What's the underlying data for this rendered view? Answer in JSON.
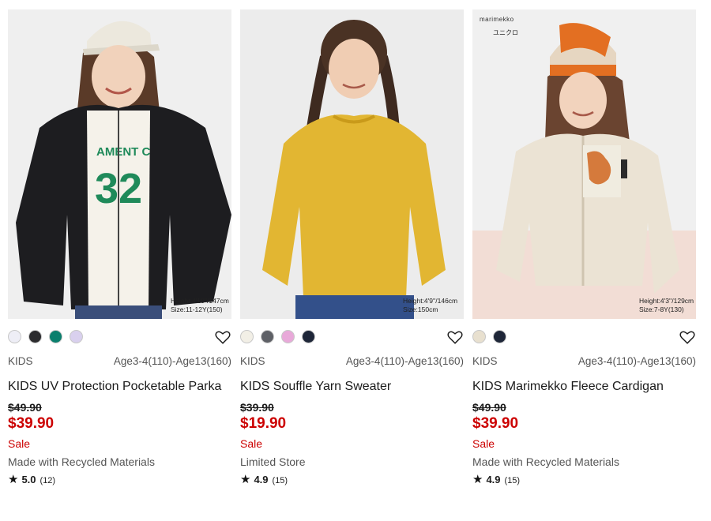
{
  "products": [
    {
      "model_height": "Height:4'10''/147cm",
      "model_size": "Size:11-12Y(150)",
      "swatches": [
        "#eeeef6",
        "#2b2b2e",
        "#0a7f6d",
        "#d9d0ee"
      ],
      "category": "KIDS",
      "sizes": "Age3-4(110)-Age13(160)",
      "title": "KIDS UV Protection Pocketable Parka",
      "old_price": "$49.90",
      "new_price": "$39.90",
      "sale": "Sale",
      "tag": "Made with Recycled Materials",
      "rating": "5.0",
      "review_count": "(12)"
    },
    {
      "model_height": "Height:4'9''/146cm",
      "model_size": "Size:150cm",
      "swatches": [
        "#f2efe6",
        "#5e6066",
        "#e8a9d9",
        "#1e2638"
      ],
      "category": "KIDS",
      "sizes": "Age3-4(110)-Age13(160)",
      "title": "KIDS Souffle Yarn Sweater",
      "old_price": "$39.90",
      "new_price": "$19.90",
      "sale": "Sale",
      "tag": "Limited Store",
      "rating": "4.9",
      "review_count": "(15)"
    },
    {
      "brand": "marimekko",
      "uq_logo": "ユニクロ",
      "model_height": "Height:4'3''/129cm",
      "model_size": "Size:7-8Y(130)",
      "swatches": [
        "#e8e0cf",
        "#1e2638"
      ],
      "category": "KIDS",
      "sizes": "Age3-4(110)-Age13(160)",
      "title": "KIDS Marimekko Fleece Cardigan",
      "old_price": "$49.90",
      "new_price": "$39.90",
      "sale": "Sale",
      "tag": "Made with Recycled Materials",
      "rating": "4.9",
      "review_count": "(15)"
    }
  ]
}
